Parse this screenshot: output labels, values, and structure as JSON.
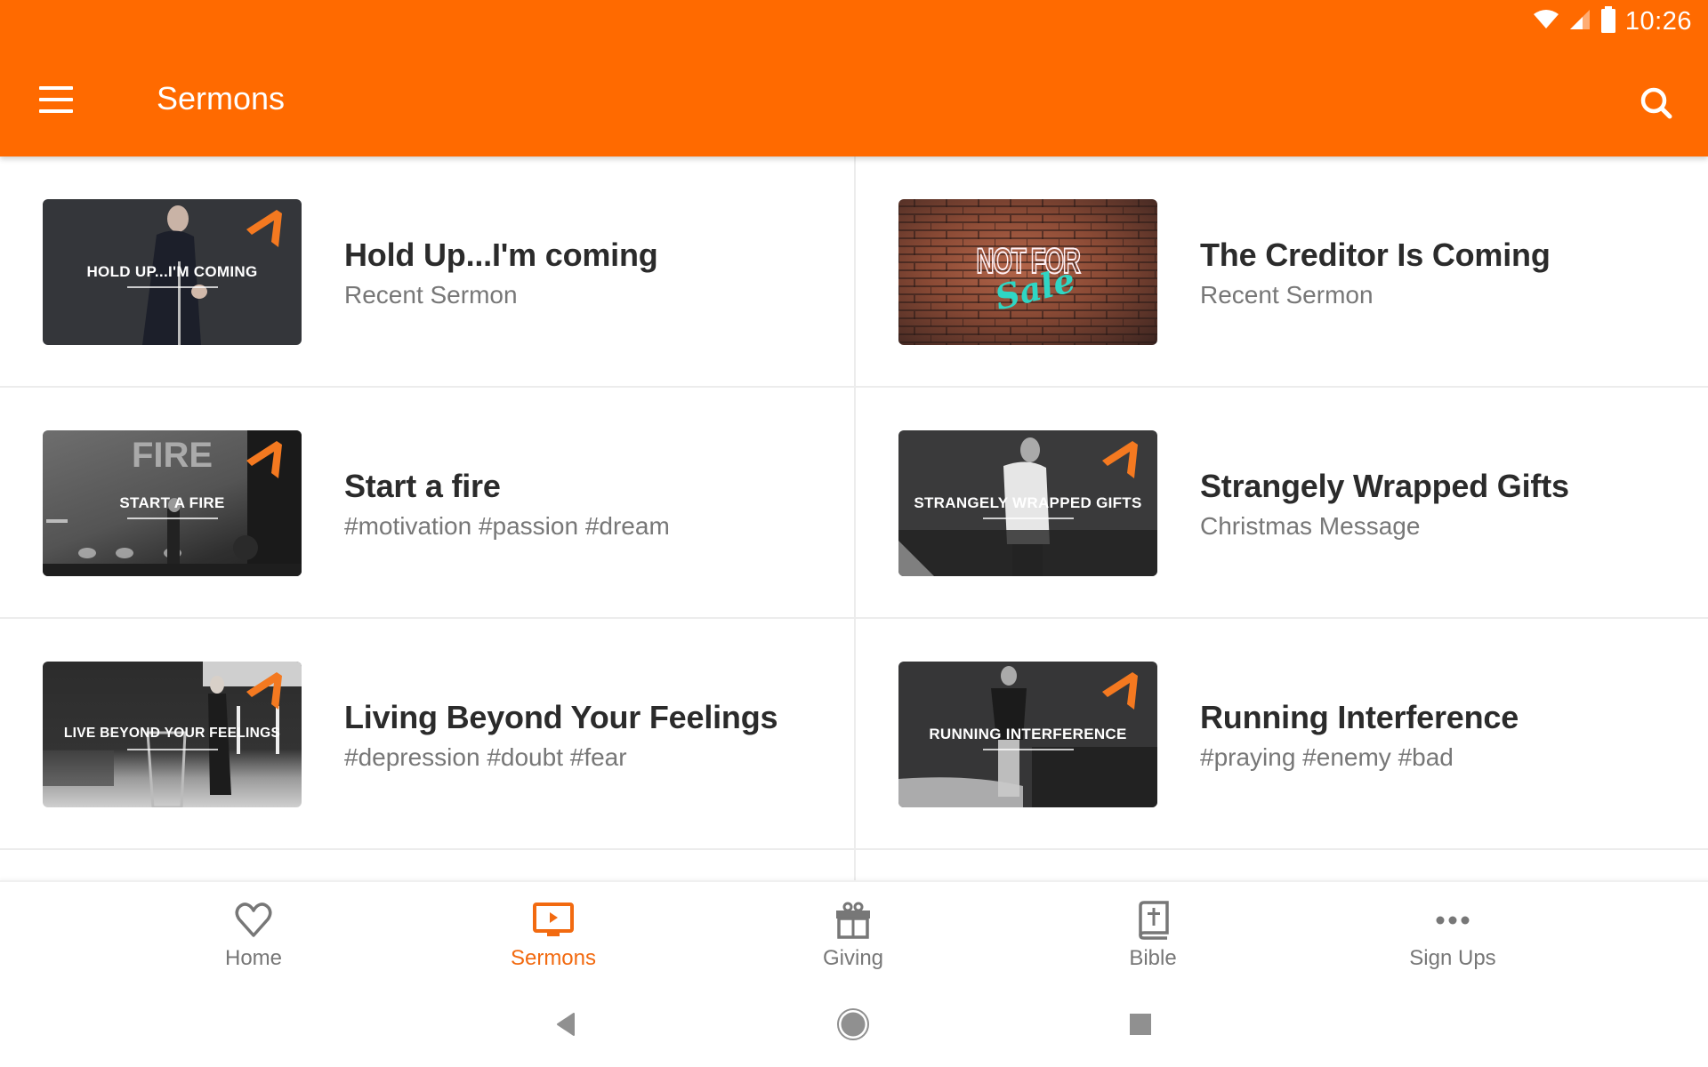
{
  "status_bar": {
    "time": "10:26",
    "icons": [
      "wifi-icon",
      "cell-signal-icon",
      "battery-icon"
    ]
  },
  "app_bar": {
    "title": "Sermons",
    "menu_icon": "hamburger-menu-icon",
    "search_icon": "search-icon"
  },
  "colors": {
    "brand": "#ff6a00",
    "active_tab": "#f26a10",
    "title_text": "#2b2b2b",
    "subtitle_text": "#777777",
    "divider": "#ececec"
  },
  "sermons": [
    {
      "title": "Hold Up...I'm coming",
      "subtitle": "Recent Sermon",
      "thumb_text": "HOLD UP...I'M COMING"
    },
    {
      "title": "The Creditor Is Coming",
      "subtitle": "Recent Sermon",
      "thumb_text": "NOT FOR Sale"
    },
    {
      "title": "Start a fire",
      "subtitle": "#motivation #passion #dream",
      "thumb_text": "START A FIRE"
    },
    {
      "title": "Strangely Wrapped Gifts",
      "subtitle": "Christmas Message",
      "thumb_text": "STRANGELY WRAPPED GIFTS"
    },
    {
      "title": "Living Beyond Your Feelings",
      "subtitle": "#depression #doubt #fear",
      "thumb_text": "LIVE BEYOND YOUR FEELINGS"
    },
    {
      "title": "Running Interference",
      "subtitle": "#praying #enemy #bad",
      "thumb_text": "RUNNING INTERFERENCE"
    }
  ],
  "thumb_extras": {
    "fire_backdrop": "FIRE",
    "not_for": "NOT FOR",
    "sale": "Sale"
  },
  "bottom_nav": [
    {
      "label": "Home",
      "icon": "heart-icon",
      "active": false
    },
    {
      "label": "Sermons",
      "icon": "video-play-icon",
      "active": true
    },
    {
      "label": "Giving",
      "icon": "gift-icon",
      "active": false
    },
    {
      "label": "Bible",
      "icon": "bible-icon",
      "active": false
    },
    {
      "label": "Sign Ups",
      "icon": "more-dots-icon",
      "active": false
    }
  ],
  "system_nav": [
    "back-icon",
    "home-circle-icon",
    "recents-square-icon"
  ]
}
